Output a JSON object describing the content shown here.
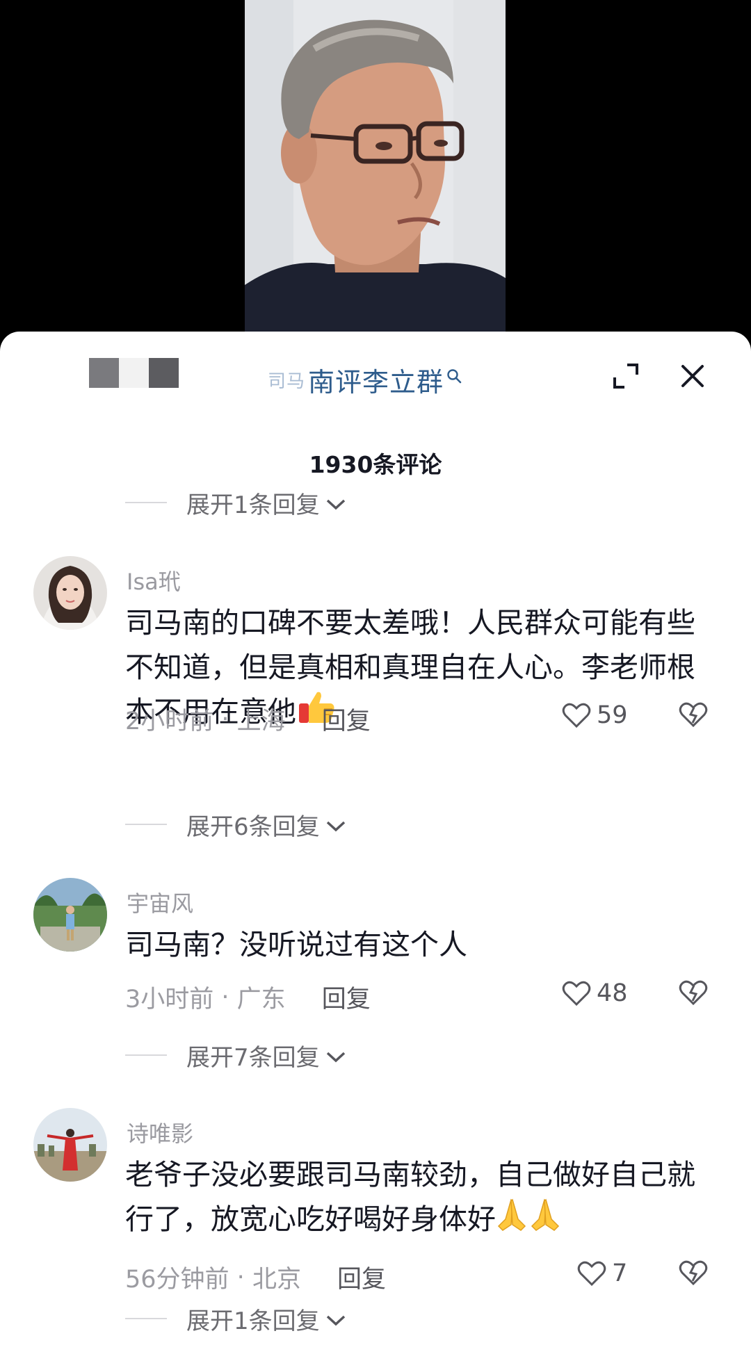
{
  "search": {
    "prefix": "司马",
    "query": "南评李立群"
  },
  "comments_count": "1930条评论",
  "reply_toggles": [
    "展开1条回复",
    "展开6条回复",
    "展开7条回复",
    "展开1条回复"
  ],
  "comments": [
    {
      "username": "Isa玳",
      "text": "司马南的口碑不要太差哦！人民群众可能有些不知道，但是真相和真理自在人心。李老师根本不用在意他",
      "emoji": "thumbs-up-emoji",
      "time": "2小时前",
      "location": "上海",
      "reply_label": "回复",
      "likes": "59"
    },
    {
      "username": "宇宙风",
      "text": "司马南？没听说过有这个人",
      "time": "3小时前",
      "location": "广东",
      "reply_label": "回复",
      "likes": "48"
    },
    {
      "username": "诗唯影",
      "text": "老爷子没必要跟司马南较劲，自己做好自己就行了，放宽心吃好喝好身体好",
      "emoji": "folded-hands-emoji",
      "time": "56分钟前",
      "location": "北京",
      "reply_label": "回复",
      "likes": "7"
    }
  ],
  "icons": [
    "search-icon",
    "expand-icon",
    "close-icon",
    "chevron-down-icon",
    "heart-icon",
    "dislike-heart-icon"
  ],
  "colors": {
    "link": "#2e5c8c",
    "text": "#161823",
    "meta": "#9b9ba1"
  }
}
